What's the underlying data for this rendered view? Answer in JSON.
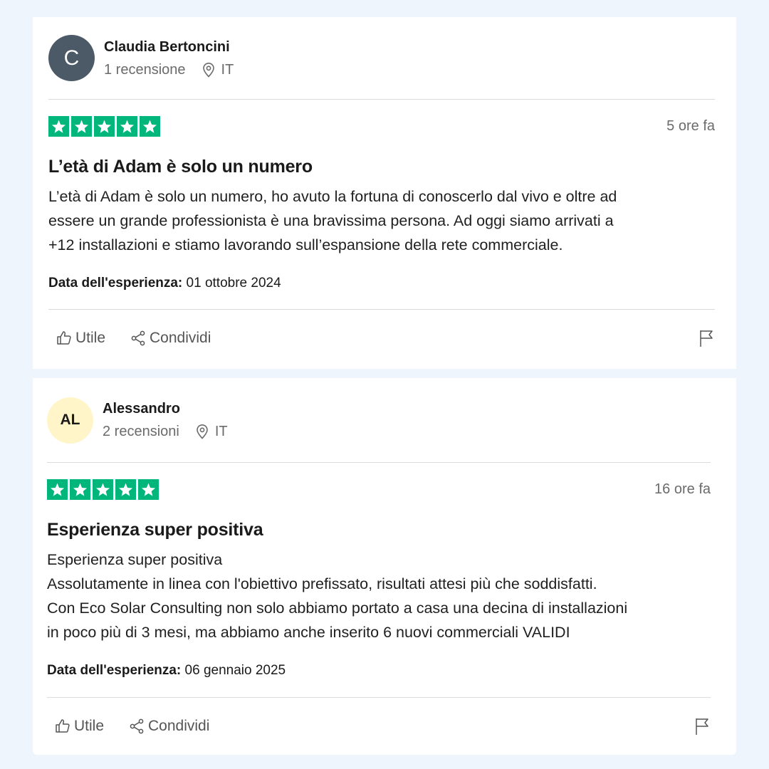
{
  "reviews": [
    {
      "avatar_initials": "C",
      "user_name": "Claudia Bertoncini",
      "review_count": "1 recensione",
      "country": "IT",
      "rating": 5,
      "time_ago": "5 ore fa",
      "title": "L’età di Adam è solo un numero",
      "body_lines": [
        "L’età di Adam è solo un numero, ho avuto la fortuna di conoscerlo dal vivo e oltre ad",
        "essere un grande professionista è una bravissima persona. Ad oggi siamo arrivati a",
        "+12 installazioni e stiamo lavorando sull’espansione della rete commerciale."
      ],
      "experience_label": "Data dell'esperienza:",
      "experience_date": " 01 ottobre 2024",
      "useful_label": "Utile",
      "share_label": "Condividi"
    },
    {
      "avatar_initials": "AL",
      "user_name": "Alessandro",
      "review_count": "2 recensioni",
      "country": "IT",
      "rating": 5,
      "time_ago": "16 ore fa",
      "title": "Esperienza super positiva",
      "body_lines": [
        "Esperienza super positiva",
        "Assolutamente in linea con l'obiettivo prefissato, risultati attesi più che soddisfatti.",
        "Con Eco Solar Consulting non solo abbiamo portato a casa una decina di installazioni",
        "in poco più di 3 mesi, ma abbiamo anche inserito 6 nuovi commerciali VALIDI"
      ],
      "experience_label": "Data dell'esperienza:",
      "experience_date": " 06 gennaio 2025",
      "useful_label": "Utile",
      "share_label": "Condividi"
    }
  ],
  "colors": {
    "star_green": "#00b67a",
    "avatar_dark": "#4b5a66",
    "avatar_light": "#fff5c8",
    "page_background": "#eef5fc"
  },
  "icons": {
    "location": "location-pin-icon",
    "star": "star-icon",
    "useful": "thumbs-up-icon",
    "share": "share-icon",
    "report": "flag-icon"
  }
}
